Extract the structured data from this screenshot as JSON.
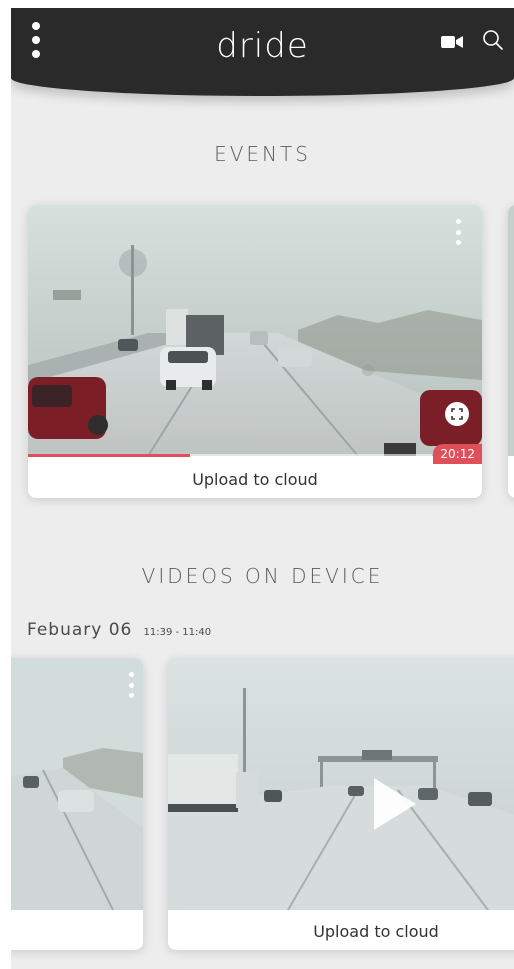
{
  "header": {
    "logo": "dride"
  },
  "events": {
    "title": "EVENTS",
    "card": {
      "caption": "Upload to cloud",
      "duration": "20:12",
      "progress": 0.4
    }
  },
  "device": {
    "title": "VIDEOS ON DEVICE",
    "date": "Febuary 06",
    "time_range": "11:39 - 11:40",
    "card2": {
      "caption": "Upload to cloud"
    }
  },
  "colors": {
    "header_bg": "#2a2a2a",
    "accent": "#e0505a",
    "page_bg": "#ededed"
  },
  "icons": {
    "menu": "kebab-vertical",
    "camera": "video-camera",
    "search": "magnifier",
    "fullscreen": "expand",
    "play": "play-triangle"
  }
}
